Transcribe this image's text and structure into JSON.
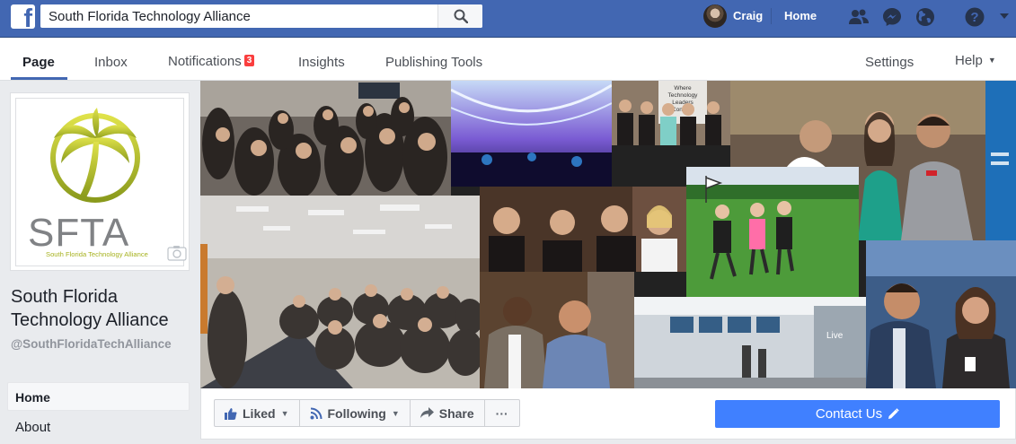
{
  "topbar": {
    "search_value": "South Florida Technology Alliance",
    "user_name": "Craig",
    "home_label": "Home",
    "brand_color": "#4267b2",
    "icons": [
      "facebook-logo-icon",
      "search-icon",
      "friend-requests-icon",
      "messenger-icon",
      "globe-icon",
      "help-icon",
      "account-caret-icon"
    ]
  },
  "tabs": {
    "page": "Page",
    "inbox": "Inbox",
    "notifications": "Notifications",
    "notifications_count": "3",
    "insights": "Insights",
    "publishing_tools": "Publishing Tools",
    "settings": "Settings",
    "help": "Help"
  },
  "profile": {
    "logo_text": "SFTA",
    "logo_subtext": "South Florida Technology Alliance",
    "page_name": "South Florida Technology Alliance",
    "page_handle": "@SouthFloridaTechAlliance"
  },
  "left_nav": {
    "home": "Home",
    "about": "About"
  },
  "cover": {
    "banner_text": "Where Technology Leaders Connect",
    "sign_text": "Live"
  },
  "actions": {
    "liked": "Liked",
    "following": "Following",
    "share": "Share",
    "more": "···",
    "contact": "Contact Us",
    "accent_color": "#4080ff"
  }
}
